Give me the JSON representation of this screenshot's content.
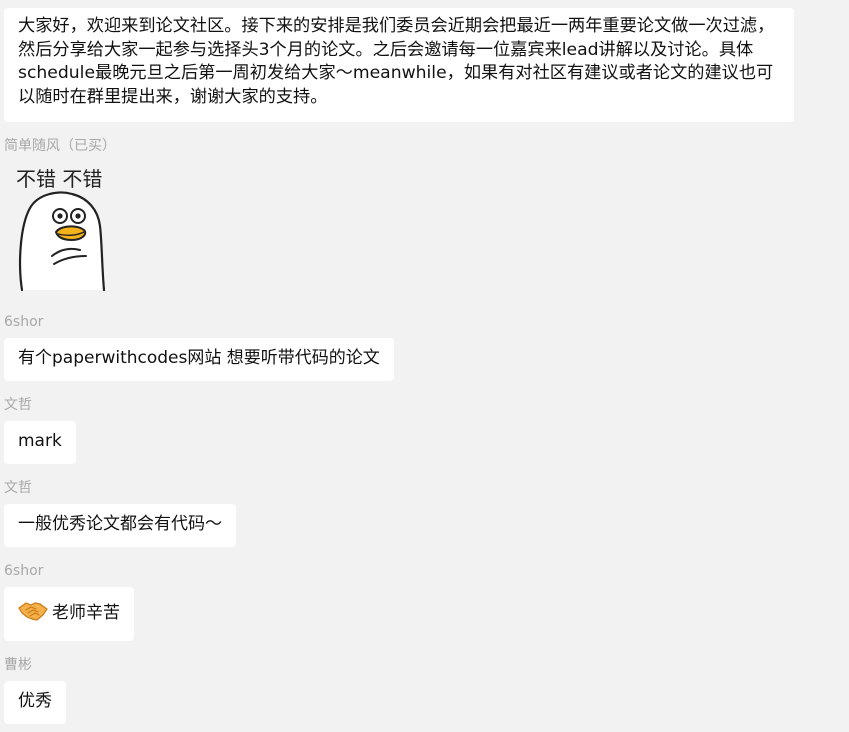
{
  "messages": [
    {
      "text": "大家好，欢迎来到论文社区。接下来的安排是我们委员会近期会把最近一两年重要论文做一次过滤，然后分享给大家一起参与选择头3个月的论文。之后会邀请每一位嘉宾来lead讲解以及讨论。具体schedule最晚元旦之后第一周初发给大家～meanwhile，如果有对社区有建议或者论文的建议也可以随时在群里提出来，谢谢大家的支持。"
    },
    {
      "sender": "简单随风（已买）",
      "sticker_text": "不错 不错"
    },
    {
      "sender": "6shor",
      "text": "有个paperwithcodes网站 想要听带代码的论文"
    },
    {
      "sender": "文哲",
      "text": "mark"
    },
    {
      "sender": "文哲",
      "text": "一般优秀论文都会有代码～"
    },
    {
      "sender": "6shor",
      "emoji": "handshake-icon",
      "text": "老师辛苦"
    },
    {
      "sender": "曹彬",
      "text": "优秀"
    }
  ],
  "colors": {
    "background": "#f2f2f2",
    "bubble": "#ffffff",
    "sender_name": "#a8a8a8",
    "text": "#111111"
  }
}
